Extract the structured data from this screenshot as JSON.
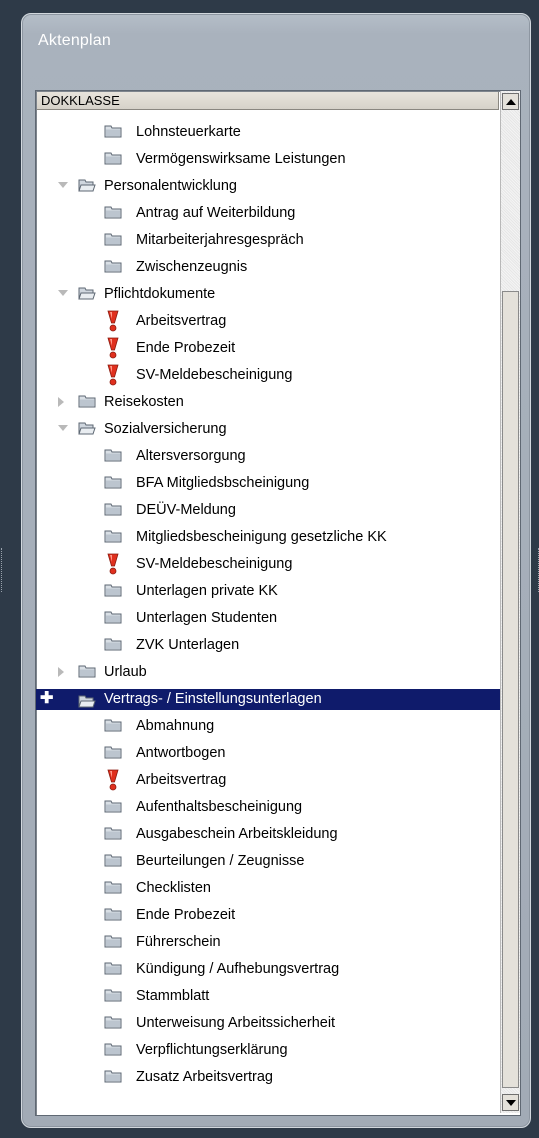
{
  "panel": {
    "title": "Aktenplan"
  },
  "tree": {
    "header": "DOKKLASSE",
    "rows": [
      {
        "label": "Lohnsteuerkarte",
        "level": 1,
        "icon": "folder-icon"
      },
      {
        "label": "Vermögenswirksame Leistungen",
        "level": 1,
        "icon": "folder-icon"
      },
      {
        "label": "Personalentwicklung",
        "level": 0,
        "icon": "folder-open-icon",
        "toggle": "expanded"
      },
      {
        "label": "Antrag auf Weiterbildung",
        "level": 1,
        "icon": "folder-icon"
      },
      {
        "label": "Mitarbeiterjahresgespräch",
        "level": 1,
        "icon": "folder-icon"
      },
      {
        "label": "Zwischenzeugnis",
        "level": 1,
        "icon": "folder-icon"
      },
      {
        "label": "Pflichtdokumente",
        "level": 0,
        "icon": "folder-open-icon",
        "toggle": "expanded"
      },
      {
        "label": "Arbeitsvertrag",
        "level": 1,
        "icon": "warning-icon"
      },
      {
        "label": "Ende Probezeit",
        "level": 1,
        "icon": "warning-icon"
      },
      {
        "label": "SV-Meldebescheinigung",
        "level": 1,
        "icon": "warning-icon"
      },
      {
        "label": "Reisekosten",
        "level": 0,
        "icon": "folder-icon",
        "toggle": "collapsed"
      },
      {
        "label": "Sozialversicherung",
        "level": 0,
        "icon": "folder-open-icon",
        "toggle": "expanded"
      },
      {
        "label": "Altersversorgung",
        "level": 1,
        "icon": "folder-icon"
      },
      {
        "label": "BFA Mitgliedsbscheinigung",
        "level": 1,
        "icon": "folder-icon"
      },
      {
        "label": "DEÜV-Meldung",
        "level": 1,
        "icon": "folder-icon"
      },
      {
        "label": "Mitgliedsbescheinigung gesetzliche KK",
        "level": 1,
        "icon": "folder-icon"
      },
      {
        "label": "SV-Meldebescheinigung",
        "level": 1,
        "icon": "warning-icon"
      },
      {
        "label": "Unterlagen private KK",
        "level": 1,
        "icon": "folder-icon"
      },
      {
        "label": "Unterlagen Studenten",
        "level": 1,
        "icon": "folder-icon"
      },
      {
        "label": "ZVK Unterlagen",
        "level": 1,
        "icon": "folder-icon"
      },
      {
        "label": "Urlaub",
        "level": 0,
        "icon": "folder-icon",
        "toggle": "collapsed"
      },
      {
        "label": "Vertrags- / Einstellungsunterlagen",
        "level": 0,
        "icon": "folder-open-icon",
        "selected": true,
        "marker": "+"
      },
      {
        "label": "Abmahnung",
        "level": 1,
        "icon": "folder-icon"
      },
      {
        "label": "Antwortbogen",
        "level": 1,
        "icon": "folder-icon"
      },
      {
        "label": "Arbeitsvertrag",
        "level": 1,
        "icon": "warning-icon"
      },
      {
        "label": "Aufenthaltsbescheinigung",
        "level": 1,
        "icon": "folder-icon"
      },
      {
        "label": "Ausgabeschein Arbeitskleidung",
        "level": 1,
        "icon": "folder-icon"
      },
      {
        "label": "Beurteilungen / Zeugnisse",
        "level": 1,
        "icon": "folder-icon"
      },
      {
        "label": "Checklisten",
        "level": 1,
        "icon": "folder-icon"
      },
      {
        "label": "Ende Probezeit",
        "level": 1,
        "icon": "folder-icon"
      },
      {
        "label": "Führerschein",
        "level": 1,
        "icon": "folder-icon"
      },
      {
        "label": "Kündigung / Aufhebungsvertrag",
        "level": 1,
        "icon": "folder-icon"
      },
      {
        "label": "Stammblatt",
        "level": 1,
        "icon": "folder-icon"
      },
      {
        "label": "Unterweisung Arbeitssicherheit",
        "level": 1,
        "icon": "folder-icon"
      },
      {
        "label": "Verpflichtungserklärung",
        "level": 1,
        "icon": "folder-icon"
      },
      {
        "label": "Zusatz Arbeitsvertrag",
        "level": 1,
        "icon": "folder-icon"
      }
    ]
  },
  "colors": {
    "background": "#2e3a48",
    "panel": "#a9b2bd",
    "selection": "#0f1b6b",
    "warning": "#e0301e"
  }
}
